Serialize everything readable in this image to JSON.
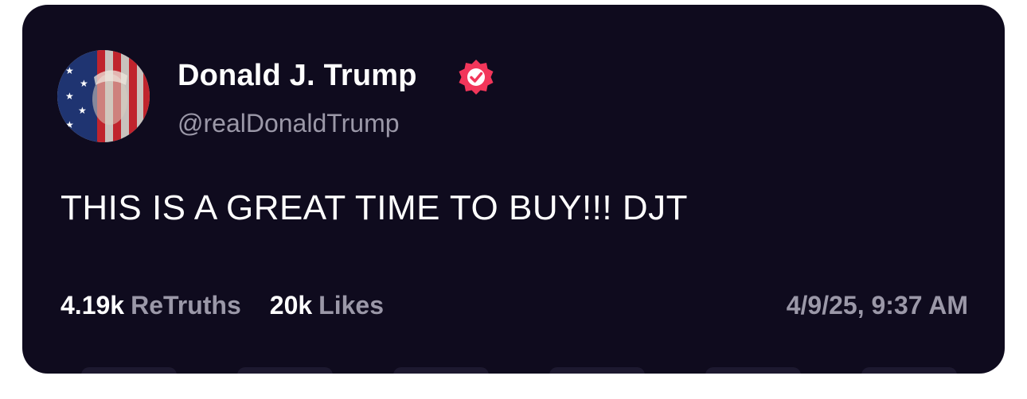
{
  "post": {
    "author": {
      "display_name": "Donald J. Trump",
      "handle": "@realDonaldTrump",
      "verified": true,
      "avatar_icon": "flag-portrait-avatar",
      "verified_icon": "verified-badge-icon"
    },
    "text": "THIS IS A GREAT TIME TO BUY!!! DJT",
    "stats": {
      "retruths_count": "4.19k",
      "retruths_label": "ReTruths",
      "likes_count": "20k",
      "likes_label": "Likes"
    },
    "timestamp": "4/9/25, 9:37 AM"
  },
  "colors": {
    "card_background": "#0f0b1e",
    "primary_text": "#ffffff",
    "secondary_text": "#9b98a8",
    "verified_badge": "#f2365a"
  }
}
